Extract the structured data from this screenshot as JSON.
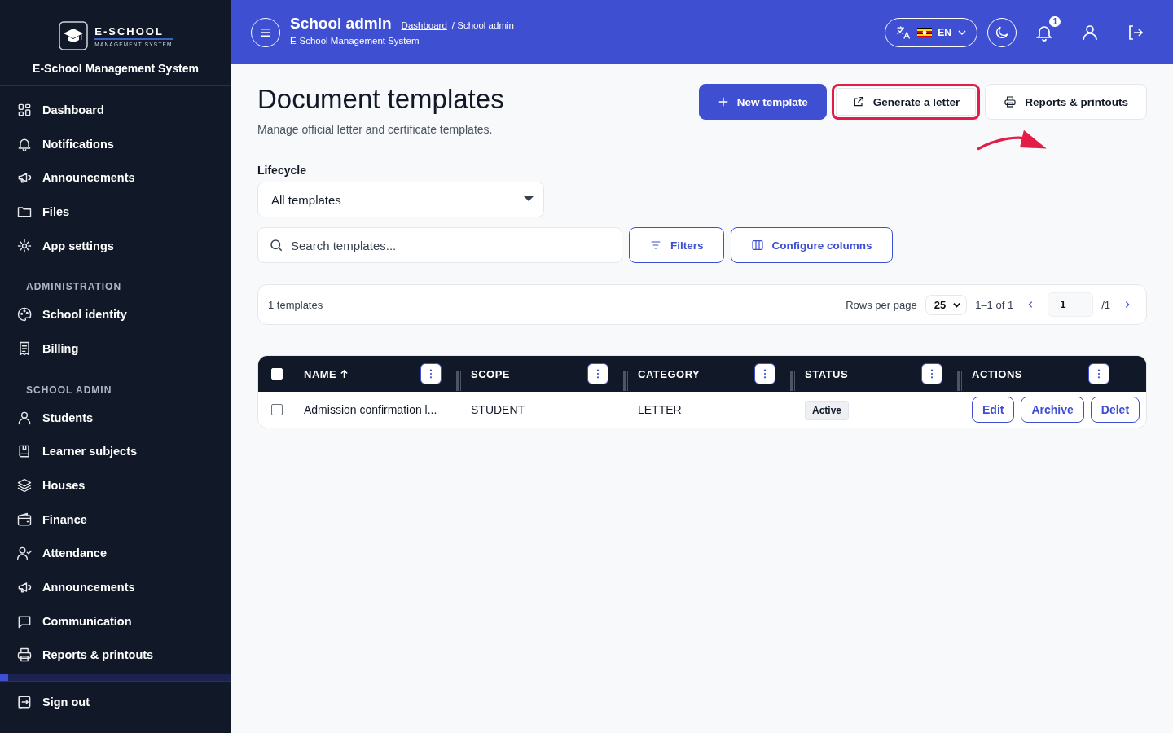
{
  "sidebar": {
    "logo": {
      "name": "E-SCHOOL",
      "tagline": "MANAGEMENT SYSTEM"
    },
    "app_name": "E-School Management System",
    "sections": [
      {
        "items": [
          {
            "label": "Dashboard",
            "selected": false
          },
          {
            "label": "Notifications",
            "selected": false
          },
          {
            "label": "Announcements",
            "selected": false
          },
          {
            "label": "Files",
            "selected": false
          },
          {
            "label": "App settings",
            "selected": false
          }
        ]
      },
      {
        "heading": "ADMINISTRATION",
        "items": [
          {
            "label": "School identity",
            "selected": false
          },
          {
            "label": "Billing",
            "selected": false
          }
        ]
      },
      {
        "heading": "SCHOOL ADMIN",
        "items": [
          {
            "label": "Students",
            "selected": false
          },
          {
            "label": "Learner subjects",
            "selected": false
          },
          {
            "label": "Houses",
            "selected": false
          },
          {
            "label": "Finance",
            "selected": false
          },
          {
            "label": "Attendance",
            "selected": false
          },
          {
            "label": "Announcements",
            "selected": false
          },
          {
            "label": "Communication",
            "selected": false
          },
          {
            "label": "Reports & printouts",
            "selected": false
          }
        ]
      }
    ],
    "sign_out": "Sign out"
  },
  "header": {
    "title": "School admin",
    "breadcrumb": {
      "link": "Dashboard",
      "current": "/ School admin"
    },
    "subtitle": "E-School Management System",
    "language": "EN",
    "notification_count": "1"
  },
  "page": {
    "title": "Document templates",
    "subtitle": "Manage official letter and certificate templates.",
    "actions": [
      {
        "label": "New template",
        "kind": "primary",
        "highlighted": false
      },
      {
        "label": "Generate a letter",
        "kind": "external",
        "highlighted": true
      },
      {
        "label": "Reports & printouts",
        "kind": "print",
        "highlighted": false
      }
    ],
    "lifecycle": {
      "label": "Lifecycle",
      "value": "All templates"
    },
    "search": {
      "placeholder": "Search templates..."
    },
    "filter_buttons": [
      {
        "label": "Filters",
        "kind": "filter"
      },
      {
        "label": "Configure columns",
        "kind": "columns"
      }
    ],
    "summary": {
      "count": "1 templates",
      "rows_per_page_label": "Rows per page",
      "rows_per_page": "25",
      "range": "1–1 of 1",
      "page": "1",
      "total_pages": "/1"
    },
    "table": {
      "all_checked": false,
      "columns": [
        {
          "label": "NAME",
          "sorted": true
        },
        {
          "label": "SCOPE",
          "sorted": false
        },
        {
          "label": "CATEGORY",
          "sorted": false
        },
        {
          "label": "STATUS",
          "sorted": false
        },
        {
          "label": "ACTIONS",
          "sorted": false
        }
      ],
      "rows": [
        {
          "checked": false,
          "name": "Admission confirmation l...",
          "scope": "STUDENT",
          "category": "LETTER",
          "status": "Active",
          "actions": [
            "Edit",
            "Archive",
            "Delet"
          ]
        }
      ]
    }
  }
}
